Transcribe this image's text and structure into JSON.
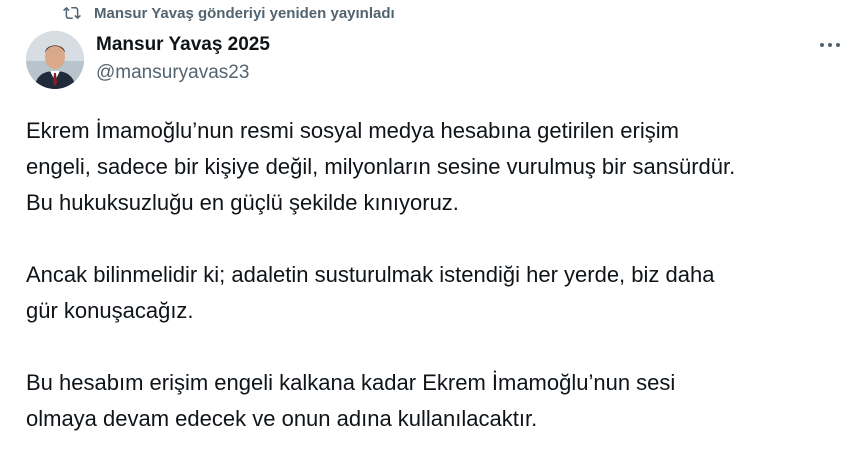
{
  "repost": {
    "icon": "repost-icon",
    "text": "Mansur Yavaş gönderiyi yeniden yayınladı"
  },
  "author": {
    "display_name": "Mansur Yavaş 2025",
    "handle": "@mansuryavas23",
    "avatar": "avatar"
  },
  "more": {
    "icon": "more-icon"
  },
  "tweet": {
    "paragraphs": [
      "Ekrem İmamoğlu’nun resmi sosyal medya hesabına getirilen erişim\nengeli, sadece bir kişiye değil, milyonların sesine vurulmuş bir sansürdür.\nBu hukuksuzluğu en güçlü şekilde kınıyoruz.",
      "Ancak bilinmelidir ki; adaletin susturulmak istendiği her yerde, biz daha\ngür konuşacağız.",
      "Bu hesabım erişim engeli kalkana kadar Ekrem İmamoğlu’nun sesi\nolmaya devam edecek ve onun adına kullanılacaktır."
    ]
  },
  "colors": {
    "text": "#0f1419",
    "muted": "#536471"
  }
}
